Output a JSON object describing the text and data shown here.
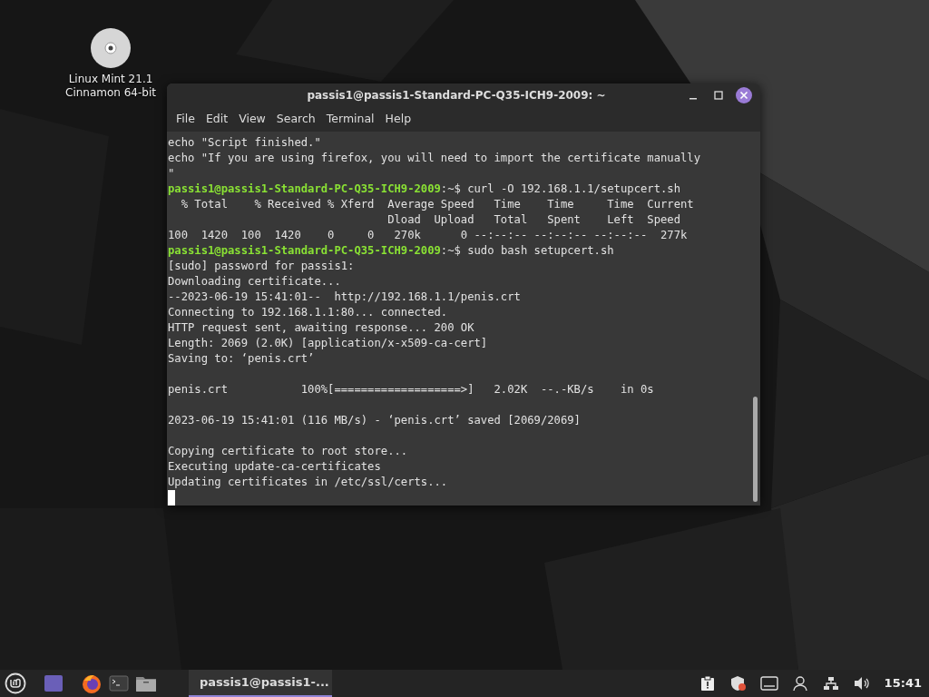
{
  "desktop_icons": [
    {
      "label": "Linux Mint 21.1\nCinnamon 64-bit"
    }
  ],
  "window": {
    "title": "passis1@passis1-Standard-PC-Q35-ICH9-2009: ~",
    "menu": [
      "File",
      "Edit",
      "View",
      "Search",
      "Terminal",
      "Help"
    ],
    "lines": [
      {
        "kind": "output",
        "text": "echo \"Script finished.\""
      },
      {
        "kind": "output",
        "text": "echo \"If you are using firefox, you will need to import the certificate manually"
      },
      {
        "kind": "output",
        "text": "\""
      },
      {
        "kind": "prompt",
        "host": "passis1@passis1-Standard-PC-Q35-ICH9-2009",
        "path": ":~$",
        "text": "curl -O 192.168.1.1/setupcert.sh"
      },
      {
        "kind": "output",
        "text": "  % Total    % Received % Xferd  Average Speed   Time    Time     Time  Current"
      },
      {
        "kind": "output",
        "text": "                                 Dload  Upload   Total   Spent    Left  Speed"
      },
      {
        "kind": "output",
        "text": "100  1420  100  1420    0     0   270k      0 --:--:-- --:--:-- --:--:--  277k"
      },
      {
        "kind": "prompt",
        "host": "passis1@passis1-Standard-PC-Q35-ICH9-2009",
        "path": ":~$",
        "text": "sudo bash setupcert.sh"
      },
      {
        "kind": "output",
        "text": "[sudo] password for passis1:"
      },
      {
        "kind": "output",
        "text": "Downloading certificate..."
      },
      {
        "kind": "output",
        "text": "--2023-06-19 15:41:01--  http://192.168.1.1/penis.crt"
      },
      {
        "kind": "output",
        "text": "Connecting to 192.168.1.1:80... connected."
      },
      {
        "kind": "output",
        "text": "HTTP request sent, awaiting response... 200 OK"
      },
      {
        "kind": "output",
        "text": "Length: 2069 (2.0K) [application/x-x509-ca-cert]"
      },
      {
        "kind": "output",
        "text": "Saving to: ‘penis.crt’"
      },
      {
        "kind": "blank"
      },
      {
        "kind": "output",
        "text": "penis.crt           100%[===================>]   2.02K  --.-KB/s    in 0s"
      },
      {
        "kind": "blank"
      },
      {
        "kind": "output",
        "text": "2023-06-19 15:41:01 (116 MB/s) - ‘penis.crt’ saved [2069/2069]"
      },
      {
        "kind": "blank"
      },
      {
        "kind": "output",
        "text": "Copying certificate to root store..."
      },
      {
        "kind": "output",
        "text": "Executing update-ca-certificates"
      },
      {
        "kind": "output",
        "text": "Updating certificates in /etc/ssl/certs..."
      },
      {
        "kind": "cursor"
      }
    ]
  },
  "taskbar": {
    "windows": [
      {
        "label": "passis1@passis1-...",
        "selected": true
      }
    ],
    "clock": "15:41"
  }
}
